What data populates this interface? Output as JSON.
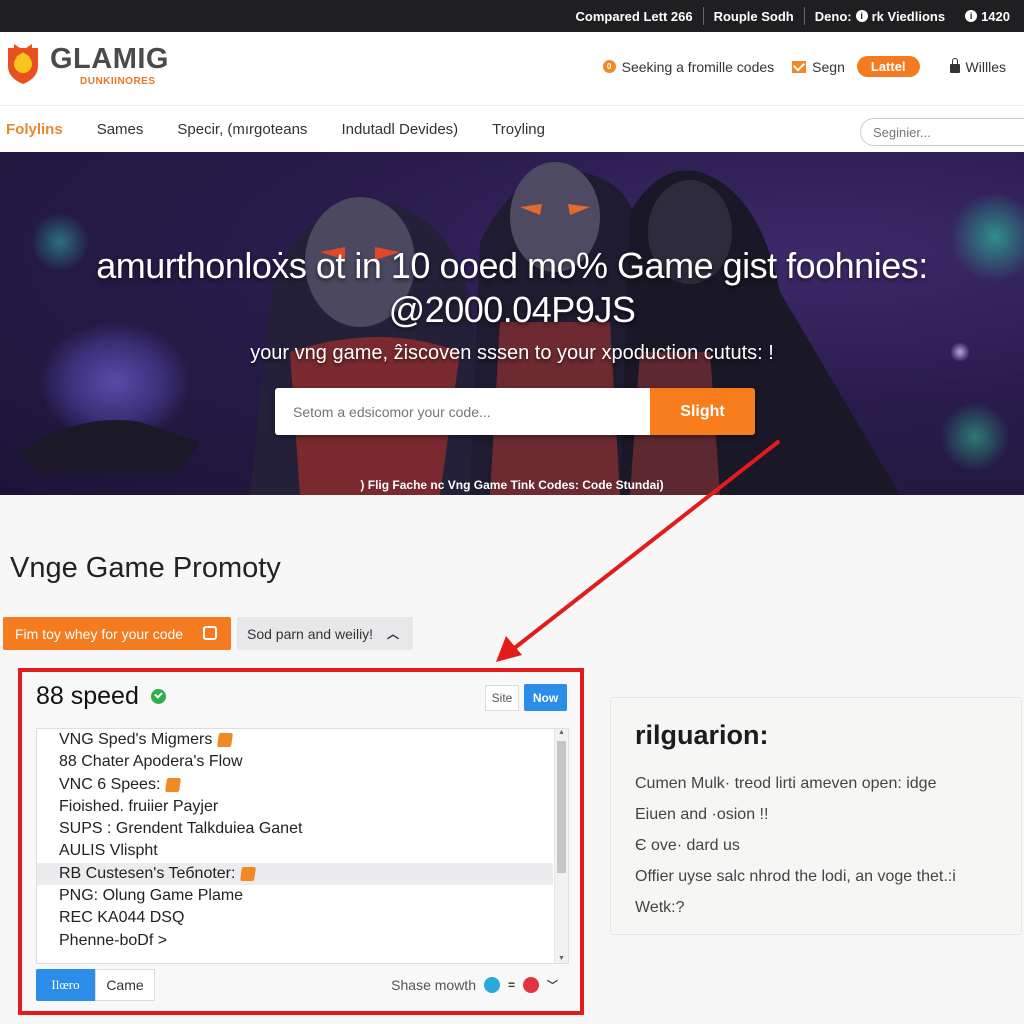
{
  "topbar": {
    "items": [
      "Compared Lett 266",
      "Rouple Sodh",
      "Deno:",
      "rk Viedlions",
      "1420"
    ]
  },
  "header": {
    "logo_title": "GLAMIG",
    "logo_subtitle": "DUNKIINORES",
    "promo_link": "Seeking a fromille codes",
    "signin_label": "Segn",
    "latest_pill": "Lattel",
    "account_label": "Willles"
  },
  "nav": {
    "items": [
      "Folylins",
      "Sames",
      "Specir, (mırgoteans",
      "Indutadl Devides)",
      "Troyling"
    ],
    "search_placeholder": "Seginier..."
  },
  "hero": {
    "title_line1": "amurthonloẋs ot in 10 ooed  mo% Game gist foohnies:",
    "title_line2": "@2000.04P9JS",
    "subtitle": "your vng game, ẑiscoven sssen to your xpoduction cututs: !",
    "search_placeholder": "Setom a edsicomor your code...",
    "search_button": "Slight",
    "caption": ") Flig Fache nc Vng Game Tink Codes: Code Stundai)"
  },
  "section": {
    "title": "Vnge Game Promoty",
    "primary_button": "Fim toy whey for your code",
    "secondary_button": "Sod parn and weiliy!"
  },
  "panel": {
    "title": "88 speed",
    "site_button": "Site",
    "now_button": "Now",
    "list": [
      {
        "label": "VNG Sped's Migmers",
        "tag": true,
        "selected": false
      },
      {
        "label": "88 Chater Apodera's Flow",
        "tag": false,
        "selected": false
      },
      {
        "label": "VNC 6 Spees:",
        "tag": true,
        "selected": false
      },
      {
        "label": "Fioished. fruiier Payjer",
        "tag": false,
        "selected": false
      },
      {
        "label": "SUPS : Grendent Talkduiea Ganet",
        "tag": false,
        "selected": false
      },
      {
        "label": "AULIS Vlispht",
        "tag": false,
        "selected": false
      },
      {
        "label": "RB Custesen's Teбnoter:",
        "tag": true,
        "selected": true
      },
      {
        "label": "PNG: Olung Game Plame",
        "tag": false,
        "selected": false
      },
      {
        "label": "REC KA044 DSQ",
        "tag": false,
        "selected": false
      },
      {
        "label": "Phenne-boDf >",
        "tag": false,
        "selected": false
      }
    ],
    "tab_active": "Ilœro",
    "tab_inactive": "Came",
    "share_label": "Shase mowth",
    "share_icon_colors": [
      "#29a9d8",
      "#e2363f"
    ]
  },
  "card": {
    "title": "rilguarion:",
    "lines": [
      "Cumen Mulk· treod lirti ameven open: idge",
      "Eiuen and ·osion !!",
      "Є ove· dard us",
      "Offier uyse salc nhrod the lodi, an voge thet.:i",
      "Wetk:?"
    ]
  },
  "colors": {
    "accent_orange": "#f47b20",
    "accent_blue": "#2b8de8",
    "annotation_red": "#e31b1b",
    "success_green": "#2fae4f"
  }
}
